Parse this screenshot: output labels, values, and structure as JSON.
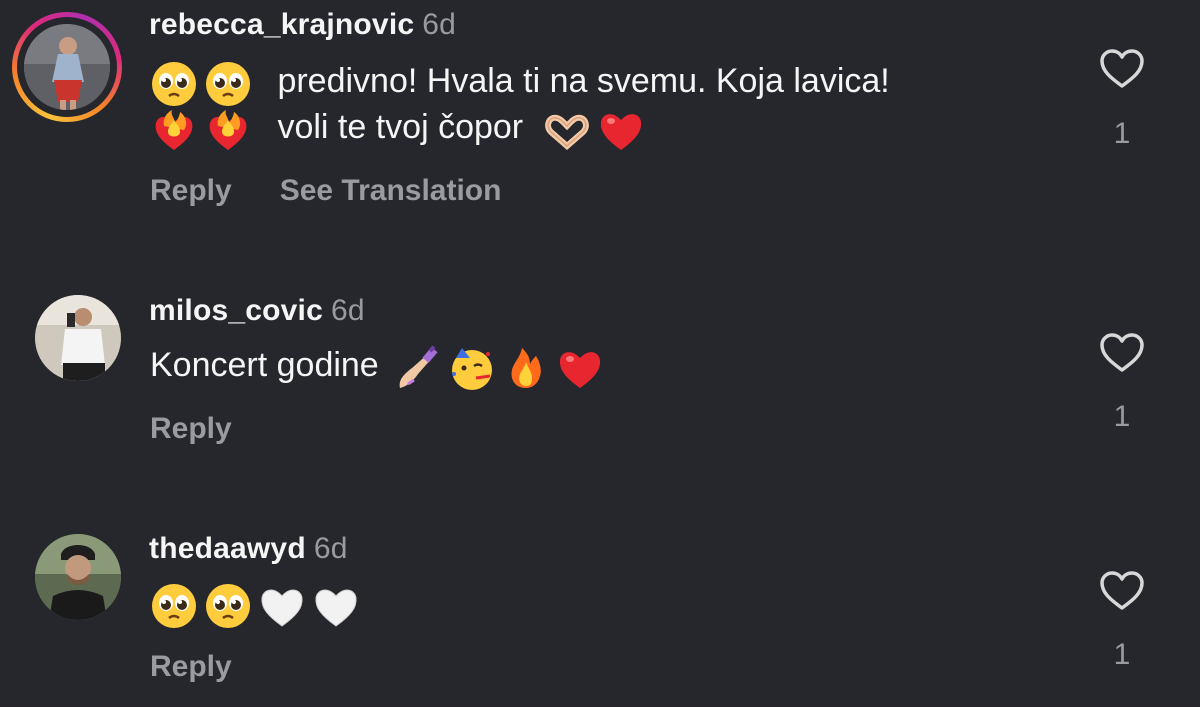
{
  "comments": [
    {
      "username": "rebecca_krajnovic",
      "time": "6d",
      "line1": "predivno! Hvala ti na svemu. Koja lavica!",
      "line2": "voli te tvoj čopor",
      "emojis_line1": [
        "pleading-face",
        "pleading-face"
      ],
      "emojis_line2_prefix": [
        "heart-on-fire",
        "heart-on-fire"
      ],
      "emojis_line2_suffix": [
        "heart-hands",
        "red-heart"
      ],
      "reply_label": "Reply",
      "translate_label": "See Translation",
      "like_count": "1",
      "has_story_ring": true
    },
    {
      "username": "milos_covic",
      "time": "6d",
      "text": "Koncert godine",
      "emojis": [
        "nail-polish",
        "partying-face",
        "fire",
        "red-heart"
      ],
      "reply_label": "Reply",
      "like_count": "1",
      "has_story_ring": false
    },
    {
      "username": "thedaawyd",
      "time": "6d",
      "text": "",
      "emojis": [
        "pleading-face",
        "pleading-face",
        "white-heart",
        "white-heart"
      ],
      "reply_label": "Reply",
      "like_count": "1",
      "has_story_ring": false
    }
  ],
  "colors": {
    "background": "#25272c",
    "primary_text": "#f5f5f5",
    "secondary_text": "#9a9ba0",
    "heart_outline": "#d8d8d8"
  },
  "icons": {
    "like": "heart-outline-icon"
  }
}
